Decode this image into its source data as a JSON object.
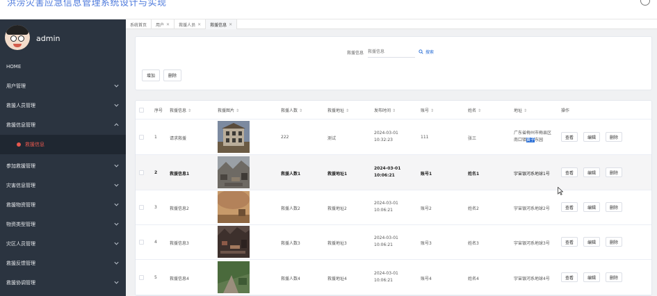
{
  "app": {
    "title": "洪涝灾害应急信息管理系统设计与实现"
  },
  "user": {
    "name": "admin"
  },
  "sidebar": {
    "home": "HOME",
    "items": [
      "用户管理",
      "救援人员管理",
      "救援信息管理",
      "救援信息",
      "参加救援管理",
      "灾害信息管理",
      "救援物资管理",
      "物资类型管理",
      "灾区人员管理",
      "救援反馈管理",
      "救援协调管理"
    ],
    "active_sub_index": 3
  },
  "tabs": [
    {
      "label": "系统首页",
      "closable": false
    },
    {
      "label": "用户",
      "closable": true
    },
    {
      "label": "救援人员",
      "closable": true
    },
    {
      "label": "救援信息",
      "closable": true
    }
  ],
  "search": {
    "label": "救援信息",
    "placeholder": "救援信息",
    "button": "搜索"
  },
  "toolbar": {
    "add": "增加",
    "delete": "删除"
  },
  "table": {
    "columns": [
      "序号",
      "救援信息",
      "救援图片",
      "救援人数",
      "救援地址",
      "发布时间",
      "账号",
      "姓名",
      "地址",
      "操作"
    ],
    "sortable": [
      false,
      true,
      true,
      true,
      true,
      true,
      true,
      true,
      true,
      false
    ],
    "actions": {
      "view": "查看",
      "edit": "编辑",
      "delete": "删除"
    },
    "rows": [
      {
        "index": "1",
        "info": "请求救援",
        "count": "222",
        "addr": "测试",
        "time": "2024-03-01 10:32:23",
        "account": "111",
        "name": "张三",
        "address_a": "广东省梅州市梅县区南口镇",
        "address_sel": "黄子",
        "address_b": "东园",
        "img": "house"
      },
      {
        "index": "2",
        "info": "救援信息1",
        "count": "救援人数1",
        "addr": "救援地址1",
        "time": "2024-03-01 10:06:21",
        "account": "账号1",
        "name": "姓名1",
        "address": "宇宙银河系地球1号",
        "img": "rubble"
      },
      {
        "index": "3",
        "info": "救援信息2",
        "count": "救援人数2",
        "addr": "救援地址2",
        "time": "2024-03-01 10:06:21",
        "account": "账号2",
        "name": "姓名2",
        "address": "宇宙银河系地球2号",
        "img": "sand"
      },
      {
        "index": "4",
        "info": "救援信息3",
        "count": "救援人数3",
        "addr": "救援地址3",
        "time": "2024-03-01 10:06:21",
        "account": "账号3",
        "name": "姓名3",
        "address": "宇宙银河系地球3号",
        "img": "debris"
      },
      {
        "index": "5",
        "info": "救援信息4",
        "count": "救援人数4",
        "addr": "救援地址4",
        "time": "2024-03-01 10:06:21",
        "account": "账号4",
        "name": "姓名4",
        "address": "宇宙银河系地球4号",
        "img": "slope"
      }
    ]
  }
}
